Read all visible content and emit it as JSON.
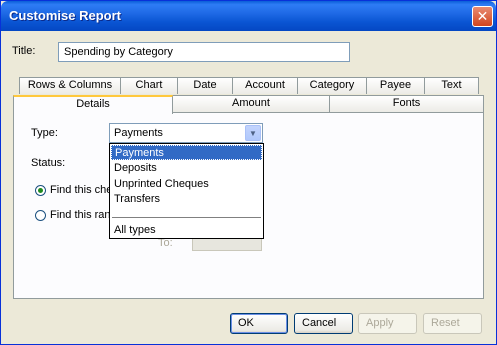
{
  "window": {
    "title": "Customise Report",
    "close_glyph": "✕"
  },
  "title_field": {
    "label": "Title:",
    "value": "Spending by Category"
  },
  "tabs_row1": [
    "Rows & Columns",
    "Chart",
    "Date",
    "Account",
    "Category",
    "Payee",
    "Text"
  ],
  "tabs_row2": [
    "Details",
    "Amount",
    "Fonts"
  ],
  "active_tab": "Details",
  "details": {
    "type_label": "Type:",
    "type_value": "Payments",
    "status_label": "Status:",
    "radio1_label": "Find this che",
    "radio2_label": "Find this ran",
    "to_label": "To:",
    "dropdown_options": [
      "Payments",
      "Deposits",
      "Unprinted Cheques",
      "Transfers"
    ],
    "dropdown_extra": "All types"
  },
  "buttons": {
    "ok": "OK",
    "cancel": "Cancel",
    "apply": "Apply",
    "reset": "Reset"
  },
  "colors": {
    "titlebar": "#0a55d3",
    "selection": "#316ac5",
    "tab_highlight": "#ffc83c"
  }
}
